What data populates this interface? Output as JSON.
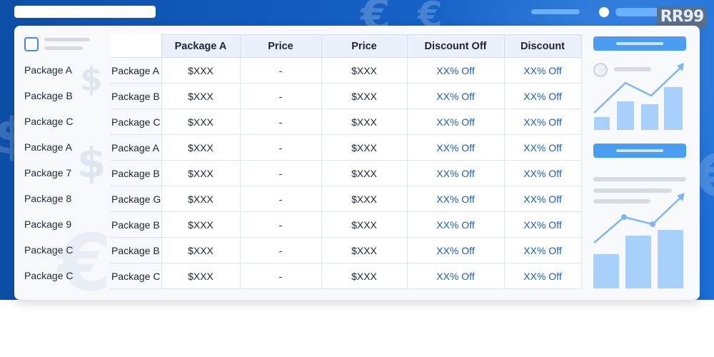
{
  "logo": {
    "text": "RR99"
  },
  "table": {
    "headers": [
      "Package A",
      "Price",
      "Price",
      "Discount Off",
      "Discount"
    ],
    "left_labels": [
      "Package A",
      "Package B",
      "Package C",
      "Package A",
      "Package 7",
      "Package 8",
      "Package 9",
      "Package C",
      "Package C"
    ],
    "rows": [
      {
        "pkg": "Package A",
        "price1": "$XXX",
        "price2": "-",
        "price3": "$XXX",
        "disc1": "XX% Off",
        "disc2": "XX% Off"
      },
      {
        "pkg": "Package B",
        "price1": "$XXX",
        "price2": "-",
        "price3": "$XXX",
        "disc1": "XX% Off",
        "disc2": "XX% Off"
      },
      {
        "pkg": "Package C",
        "price1": "$XXX",
        "price2": "-",
        "price3": "$XXX",
        "disc1": "XX% Off",
        "disc2": "XX% Off"
      },
      {
        "pkg": "Package A",
        "price1": "$XXX",
        "price2": "-",
        "price3": "$XXX",
        "disc1": "XX% Off",
        "disc2": "XX% Off"
      },
      {
        "pkg": "Package B",
        "price1": "$XXX",
        "price2": "-",
        "price3": "$XXX",
        "disc1": "XX% Off",
        "disc2": "XX% Off"
      },
      {
        "pkg": "Package G",
        "price1": "$XXX",
        "price2": "-",
        "price3": "$XXX",
        "disc1": "XX% Off",
        "disc2": "XX% Off"
      },
      {
        "pkg": "Package B",
        "price1": "$XXX",
        "price2": "-",
        "price3": "$XXX",
        "disc1": "XX% Off",
        "disc2": "XX% Off"
      },
      {
        "pkg": "Package B",
        "price1": "$XXX",
        "price2": "-",
        "price3": "$XXX",
        "disc1": "XX% Off",
        "disc2": "XX% Off"
      },
      {
        "pkg": "Package C",
        "price1": "$XXX",
        "price2": "-",
        "price3": "$XXX",
        "disc1": "XX% Off",
        "disc2": "XX% Off"
      }
    ]
  },
  "colors": {
    "header_blue": "#1560c4",
    "accent": "#4a9df0",
    "discount_text": "#1a5fb4"
  },
  "icons": [
    "dollar-icon",
    "euro-icon",
    "clock-icon",
    "trend-arrow-icon"
  ]
}
